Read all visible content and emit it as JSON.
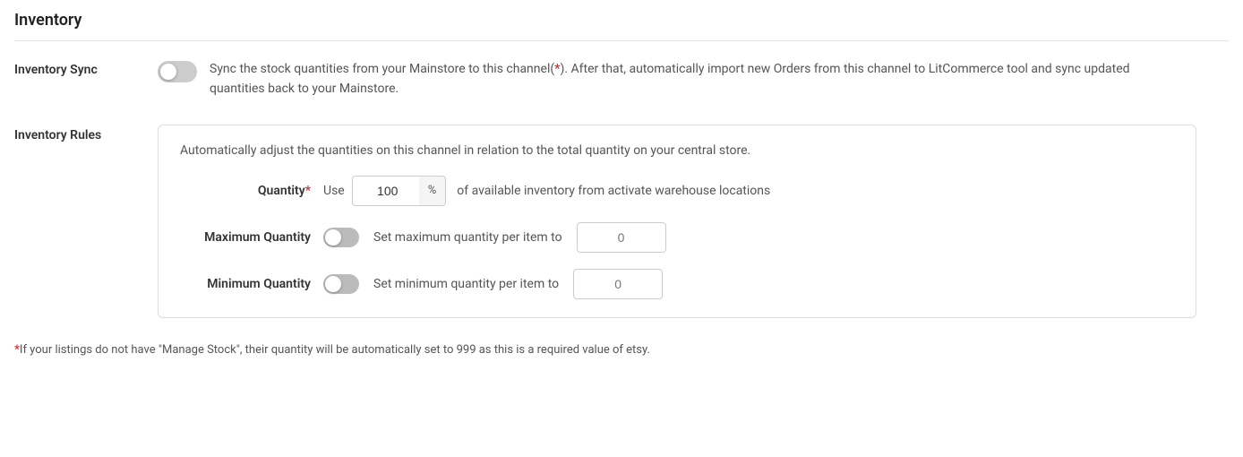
{
  "page": {
    "title": "Inventory"
  },
  "inventory_sync": {
    "label": "Inventory Sync",
    "toggle_active": false,
    "description_parts": [
      "Sync the stock quantities from your Mainstore to this channel(",
      "*",
      "). After that, automatically import new Orders from this channel to LitCommerce tool and sync updated quantities back to your Mainstore."
    ]
  },
  "inventory_rules": {
    "label": "Inventory Rules",
    "box_description": "Automatically adjust the quantities on this channel in relation to the total quantity on your central store.",
    "quantity_row": {
      "label": "Quantity",
      "required": true,
      "use_label": "Use",
      "value": "100",
      "percent_symbol": "%",
      "suffix_text": "of available inventory from activate warehouse locations"
    },
    "maximum_quantity_row": {
      "label": "Maximum Quantity",
      "toggle_active": false,
      "set_text": "Set maximum quantity per item to",
      "input_placeholder": "0"
    },
    "minimum_quantity_row": {
      "label": "Minimum Quantity",
      "toggle_active": false,
      "set_text": "Set minimum quantity per item to",
      "input_placeholder": "0"
    },
    "footnote_parts": [
      "*",
      "If your listings do not have \"Manage Stock\", their quantity will be automatically set to 999 as this is a required value of etsy."
    ]
  }
}
